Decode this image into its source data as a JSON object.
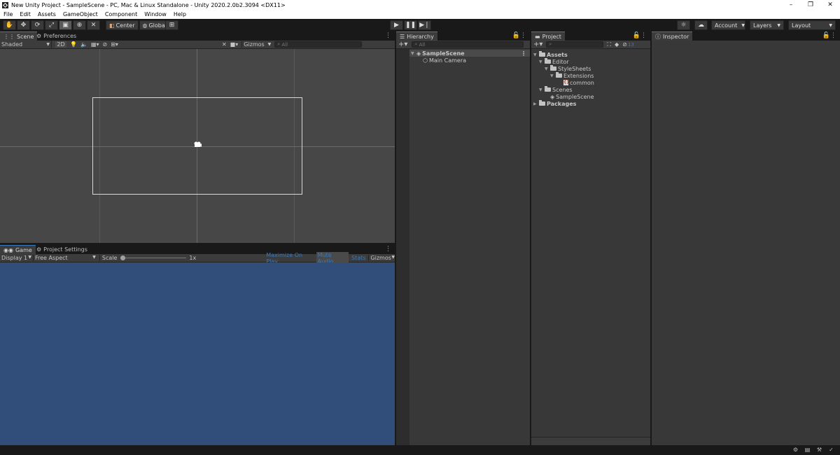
{
  "window": {
    "title": "New Unity Project - SampleScene - PC, Mac & Linux Standalone - Unity 2020.2.0b2.3094 <DX11>",
    "minimize": "–",
    "restore": "❐",
    "close": "✕"
  },
  "menu": [
    "File",
    "Edit",
    "Assets",
    "GameObject",
    "Component",
    "Window",
    "Help"
  ],
  "toolbar": {
    "pivot_label": "Center",
    "space_label": "Global",
    "account_label": "Account",
    "layers_label": "Layers",
    "layout_label": "Layout"
  },
  "scene": {
    "tab": "Scene",
    "tab2": "Preferences",
    "draw_mode": "Shaded",
    "mode_2d": "2D",
    "gizmos": "Gizmos",
    "search_placeholder": "All"
  },
  "game": {
    "tab": "Game",
    "tab2": "Project Settings",
    "display": "Display 1",
    "aspect": "Free Aspect",
    "scale_label": "Scale",
    "scale_value": "1x",
    "maximize": "Maximize On Play",
    "mute": "Mute Audio",
    "stats": "Stats",
    "gizmos": "Gizmos",
    "background_color": "#314d79"
  },
  "hierarchy": {
    "tab": "Hierarchy",
    "search_placeholder": "All",
    "scene_name": "SampleScene",
    "items": [
      "Main Camera"
    ]
  },
  "project": {
    "tab": "Project",
    "badge": "13",
    "tree": {
      "assets": "Assets",
      "editor": "Editor",
      "stylesheets": "StyleSheets",
      "extensions": "Extensions",
      "common": "common",
      "scenes": "Scenes",
      "samplescene": "SampleScene",
      "packages": "Packages"
    }
  },
  "inspector": {
    "tab": "Inspector"
  },
  "colors": {
    "accent": "#3a79bb",
    "scene_bg": "#474747",
    "panel_bg": "#383838"
  }
}
